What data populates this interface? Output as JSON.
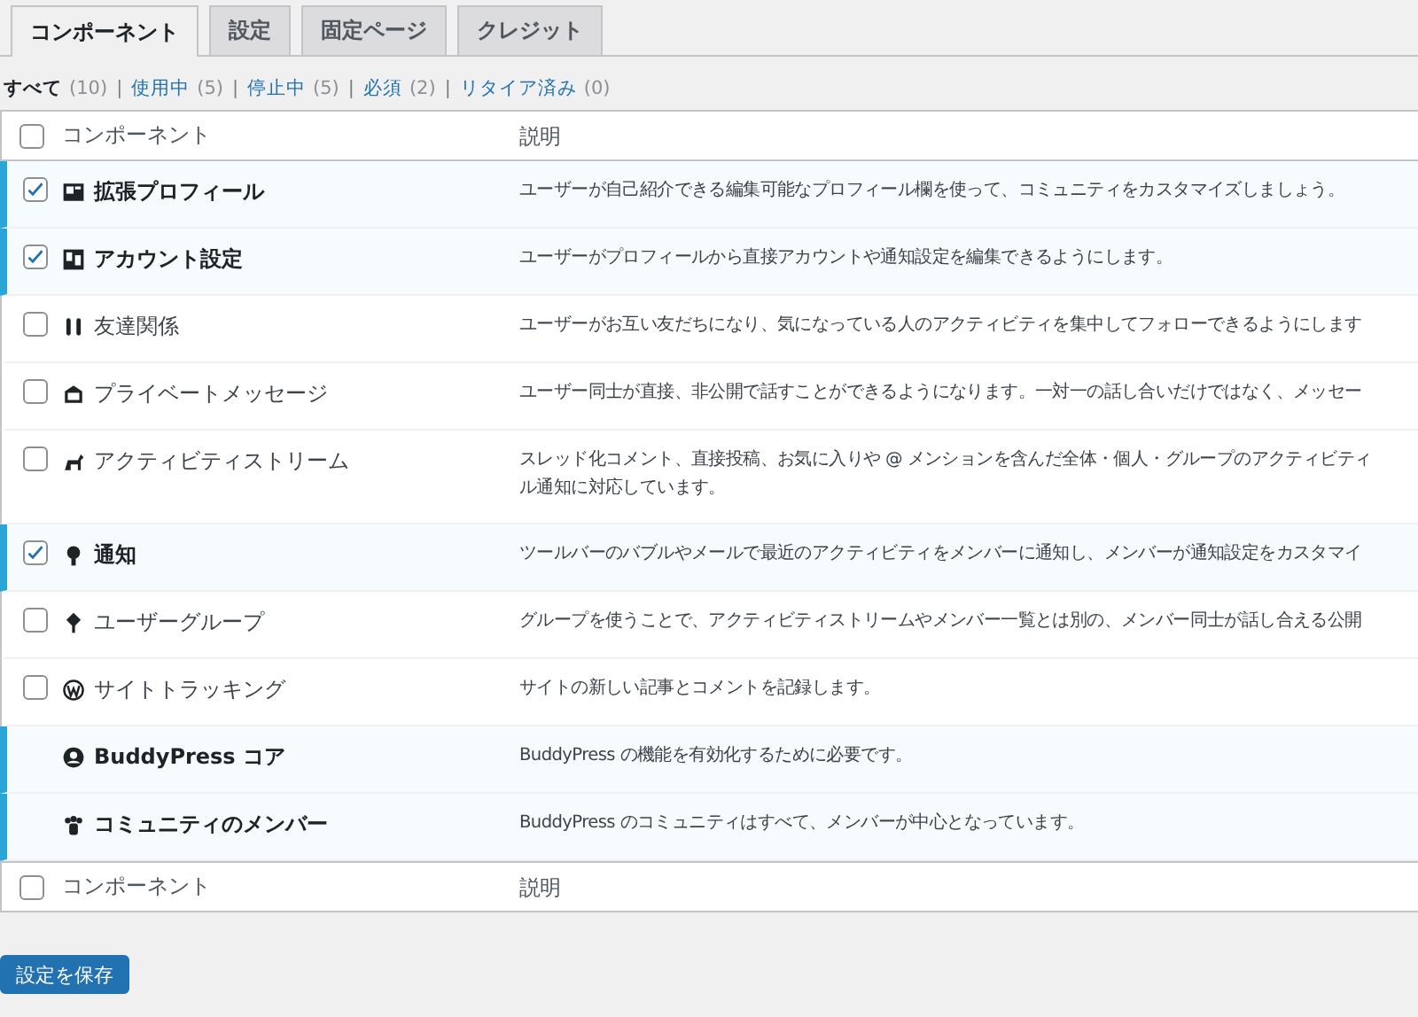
{
  "tabs": [
    {
      "label": "コンポーネント",
      "selected": true
    },
    {
      "label": "設定",
      "selected": false
    },
    {
      "label": "固定ページ",
      "selected": false
    },
    {
      "label": "クレジット",
      "selected": false
    }
  ],
  "filters": [
    {
      "label": "すべて",
      "count": "(10)",
      "selected": true
    },
    {
      "separator": "|",
      "label": "使用中",
      "count": "(5)",
      "selected": false
    },
    {
      "separator": "|",
      "label": "停止中",
      "count": "(5)",
      "selected": false
    },
    {
      "separator": "|",
      "label": "必須",
      "count": "(2)",
      "selected": false
    },
    {
      "separator": "|",
      "label": "リタイア済み",
      "count": "(0)",
      "selected": false
    }
  ],
  "table": {
    "columns": [
      "コンポーネント",
      "説明"
    ],
    "select_all_checked": false,
    "rows": [
      {
        "kind": "optional",
        "active": true,
        "checked": true,
        "name": "拡張プロフィール",
        "description": "ユーザーが自己紹介できる編集可能なプロフィール欄を使って、コミュニティをカスタマイズしましょう。"
      },
      {
        "kind": "optional",
        "active": true,
        "checked": true,
        "name": "アカウント設定",
        "description": "ユーザーがプロフィールから直接アカウントや通知設定を編集できるようにします。"
      },
      {
        "kind": "optional",
        "active": false,
        "checked": false,
        "name": "友達関係",
        "description": "ユーザーがお互い友だちになり、気になっている人のアクティビティを集中してフォローできるようにします"
      },
      {
        "kind": "optional",
        "active": false,
        "checked": false,
        "name": "プライベートメッセージ",
        "description": "ユーザー同士が直接、非公開で話すことができるようになります。一対一の話し合いだけではなく、メッセー"
      },
      {
        "kind": "optional",
        "active": false,
        "checked": false,
        "name": "アクティビティストリーム",
        "description": "スレッド化コメント、直接投稿、お気に入りや @ メンションを含んだ全体・個人・グループのアクティビティ",
        "description_2": "ル通知に対応しています。"
      },
      {
        "kind": "optional",
        "active": true,
        "checked": true,
        "name": "通知",
        "description": "ツールバーのバブルやメールで最近のアクティビティをメンバーに通知し、メンバーが通知設定をカスタマイ"
      },
      {
        "kind": "optional",
        "active": false,
        "checked": false,
        "name": "ユーザーグループ",
        "description": "グループを使うことで、アクティビティストリームやメンバー一覧とは別の、メンバー同士が話し合える公開"
      },
      {
        "kind": "optional",
        "active": false,
        "checked": false,
        "name": "サイトトラッキング",
        "description": "サイトの新しい記事とコメントを記録します。"
      },
      {
        "kind": "required",
        "active": true,
        "name": "BuddyPress コア",
        "description": "BuddyPress の機能を有効化するために必要です。"
      },
      {
        "kind": "required",
        "active": true,
        "name": "コミュニティのメンバー",
        "description": "BuddyPress のコミュニティはすべて、メンバーが中心となっています。"
      }
    ],
    "footer_columns": [
      "コンポーネント",
      "説明"
    ],
    "footer_select_all_checked": false
  },
  "save_button": "設定を保存"
}
